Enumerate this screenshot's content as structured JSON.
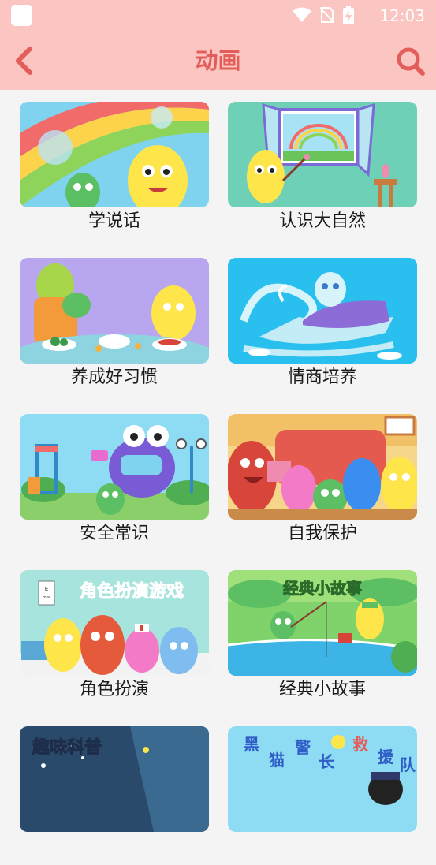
{
  "status_bar": {
    "time": "12:03"
  },
  "header": {
    "title": "动画",
    "back_icon": "chevron-left-icon",
    "search_icon": "search-icon",
    "accent": "#e35e5a",
    "background": "#fbc5c2"
  },
  "categories": [
    {
      "label": "学说话"
    },
    {
      "label": "认识大自然"
    },
    {
      "label": "养成好习惯"
    },
    {
      "label": "情商培养"
    },
    {
      "label": "安全常识"
    },
    {
      "label": "自我保护"
    },
    {
      "label": "角色扮演",
      "banner": "角色扮演游戏"
    },
    {
      "label": "经典小故事",
      "banner": "经典小故事"
    },
    {
      "label": "",
      "banner": "趣味科普"
    },
    {
      "label": "",
      "banner": "黑猫警长救援队"
    }
  ]
}
